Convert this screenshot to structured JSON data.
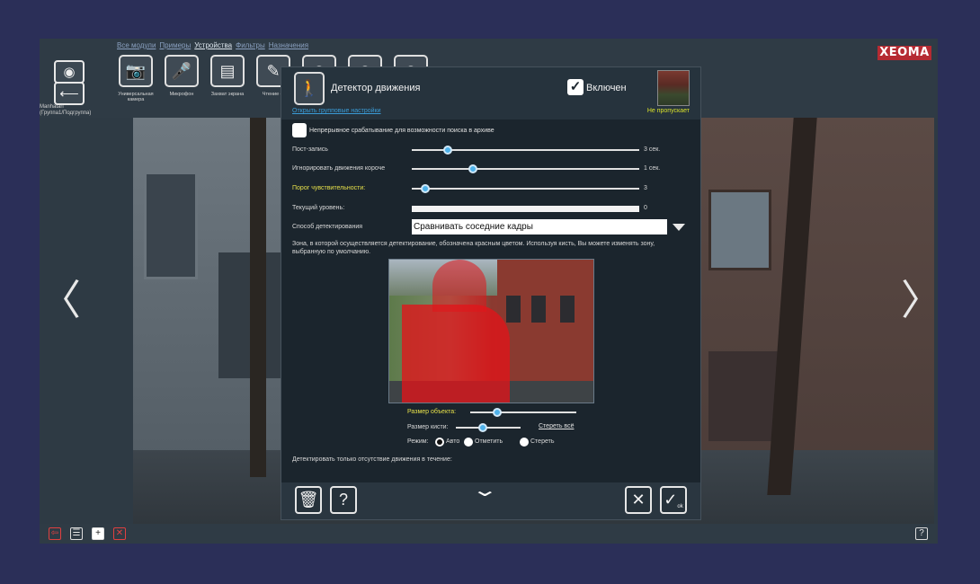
{
  "nav": {
    "links": [
      "Все модули",
      "Примеры",
      "Устройства",
      "Фильтры",
      "Назначения"
    ],
    "active_index": 2
  },
  "brand": {
    "logo": "XEOMA",
    "color": "#b52a32"
  },
  "toolbar": {
    "view_icon": "eye-icon",
    "back_icon": "return-arrow-icon",
    "camera_name": "Manhatan",
    "camera_group": "(Группа1/Подгруппа)"
  },
  "modules": [
    {
      "label": "Универсальная камера",
      "icon": "camera-icon"
    },
    {
      "label": "Микрофон",
      "icon": "microphone-icon"
    },
    {
      "label": "Захват экрана",
      "icon": "screen-capture-icon"
    },
    {
      "label": "Чтение ф",
      "icon": "file-read-icon"
    }
  ],
  "dialog": {
    "title": "Детектор движения",
    "enabled_label": "Включен",
    "enabled": true,
    "group_settings_link": "Открыть групповые настройки",
    "status": "Не пропускает",
    "continuous_label": "Непрерывное срабатывание для возможности поиска в архиве",
    "rows": [
      {
        "label": "Пост-запись",
        "value": "3 сек.",
        "fraction": 0.16,
        "highlight": false
      },
      {
        "label": "Игнорировать движения короче",
        "value": "1 сек.",
        "fraction": 0.27,
        "highlight": false
      },
      {
        "label": "Порог чувствительности:",
        "value": "3",
        "fraction": 0.06,
        "highlight": true
      }
    ],
    "current_level_label": "Текущий уровень:",
    "current_level_value": "0",
    "method_label": "Способ детектирования",
    "method_value": "Сравнивать соседние кадры",
    "zone_text": "Зона, в которой осуществляется детектирование, обозначена красным цветом. Используя кисть, Вы можете изменять зону, выбранную по умолчанию.",
    "object_size_label": "Размер объекта:",
    "object_size_fraction": 0.25,
    "brush_size_label": "Размер кисти:",
    "brush_size_fraction": 0.42,
    "clear_all": "Стереть всё",
    "mode_label": "Режим:",
    "mode_options": [
      "Авто",
      "Отметить",
      "Стереть"
    ],
    "mode_selected": 0,
    "detect_absence": "Детектировать только отсутствие движения в течение:",
    "ok_sub": "ok"
  },
  "nav_arrows": {
    "left": "〈",
    "right": "〉"
  },
  "colors": {
    "accent": "#4fb2ea",
    "highlight": "#e6e04a",
    "zone": "#e11419"
  }
}
